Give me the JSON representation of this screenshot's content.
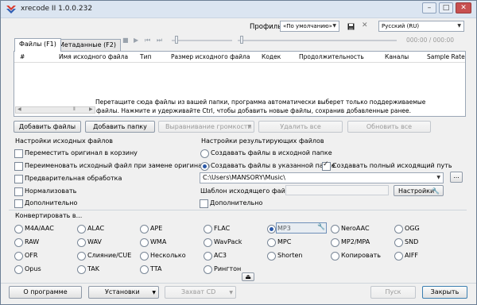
{
  "window": {
    "title": "xrecode II 1.0.0.232",
    "minimize": "–",
    "maximize": "□",
    "close": "✕"
  },
  "header": {
    "profile_label": "Профиль",
    "profile_value": "«По умолчанию»",
    "language_value": "Русский (RU)",
    "time_display": "000:00 / 000:00"
  },
  "tabs": [
    {
      "label": "Файлы (F1)"
    },
    {
      "label": "Метаданные (F2)"
    }
  ],
  "files_table": {
    "columns": [
      "#",
      "Имя исходного файла",
      "Тип",
      "Размер исходного файла",
      "Кодек",
      "Продолжительность",
      "Каналы",
      "Sample Rate"
    ],
    "hint_line1": "Перетащите сюда файлы из вашей папки, программа автоматически выберет только поддерживаемые",
    "hint_line2": "файлы. Нажмите и удерживайте Ctrl, чтобы добавить новые файлы, сохранив добавленные ранее."
  },
  "actions": {
    "add_files": "Добавить файлы",
    "add_folder": "Добавить папку",
    "volume_align": "Выравнивание громкости",
    "delete_all": "Удалить все",
    "refresh_all": "Обновить все"
  },
  "source_settings": {
    "title": "Настройки исходных файлов",
    "options": [
      {
        "label": "Переместить оригинал в корзину",
        "checked": false
      },
      {
        "label": "Переименовать исходный файл при замене оригинала",
        "checked": false
      },
      {
        "label": "Предварительная обработка",
        "checked": false
      },
      {
        "label": "Нормализовать",
        "checked": false
      },
      {
        "label": "Дополнительно",
        "checked": false
      }
    ]
  },
  "output_settings": {
    "title": "Настройки результирующих файлов",
    "radio_source_folder": "Создавать файлы в исходной папке",
    "radio_custom_folder": "Создавать файлы в указанной папке",
    "create_full_path": "Создавать полный исходящий путь",
    "path_value": "C:\\Users\\MANSORY\\Music\\",
    "browse_button": "...",
    "template_label": "Шаблон исходящего файла:",
    "template_value": "",
    "settings_button": "Настройки",
    "additional": "Дополнительно"
  },
  "convert": {
    "title": "Конвертировать в...",
    "selected": "MP3",
    "formats": [
      [
        "M4A/AAC",
        "ALAC",
        "APE",
        "FLAC",
        "MP3",
        "NeroAAC",
        "OGG"
      ],
      [
        "RAW",
        "WAV",
        "WMA",
        "WavPack",
        "MPC",
        "MP2/MPA",
        "SND"
      ],
      [
        "OFR",
        "Слияние/CUE",
        "Несколько",
        "AC3",
        "Shorten",
        "Копировать",
        "AIFF"
      ],
      [
        "Opus",
        "TAK",
        "TTA",
        "Рингтон"
      ]
    ]
  },
  "footer": {
    "about": "О программе",
    "settings": "Установки",
    "cd_grab": "Захват CD",
    "start": "Пуск",
    "close": "Закрыть"
  },
  "colors": {
    "accent": "#2a58a8",
    "titlebar": "#dbe5f1",
    "close_button": "#c75050"
  }
}
